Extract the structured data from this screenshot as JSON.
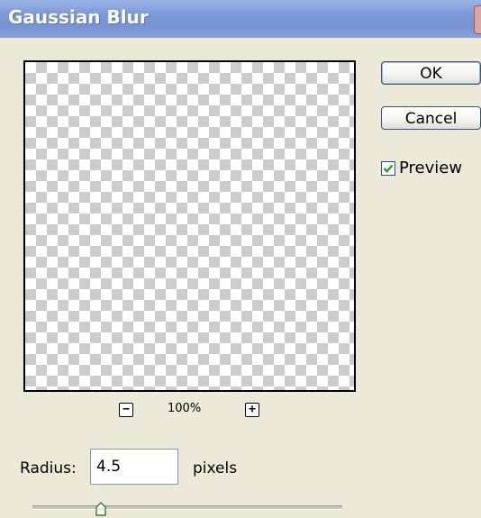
{
  "dialog": {
    "title": "Gaussian Blur"
  },
  "buttons": {
    "ok_label": "OK",
    "cancel_label": "Cancel"
  },
  "preview_toggle": {
    "label": "Preview",
    "checked": true
  },
  "zoom": {
    "out_symbol": "−",
    "in_symbol": "+",
    "level": "100%"
  },
  "radius": {
    "label": "Radius:",
    "value": "4.5",
    "unit": "pixels",
    "slider_position": 0.22
  },
  "colors": {
    "titlebar": "#7f9ad8",
    "dialog_bg": "#ece9d8",
    "checkmark": "#21a121"
  }
}
